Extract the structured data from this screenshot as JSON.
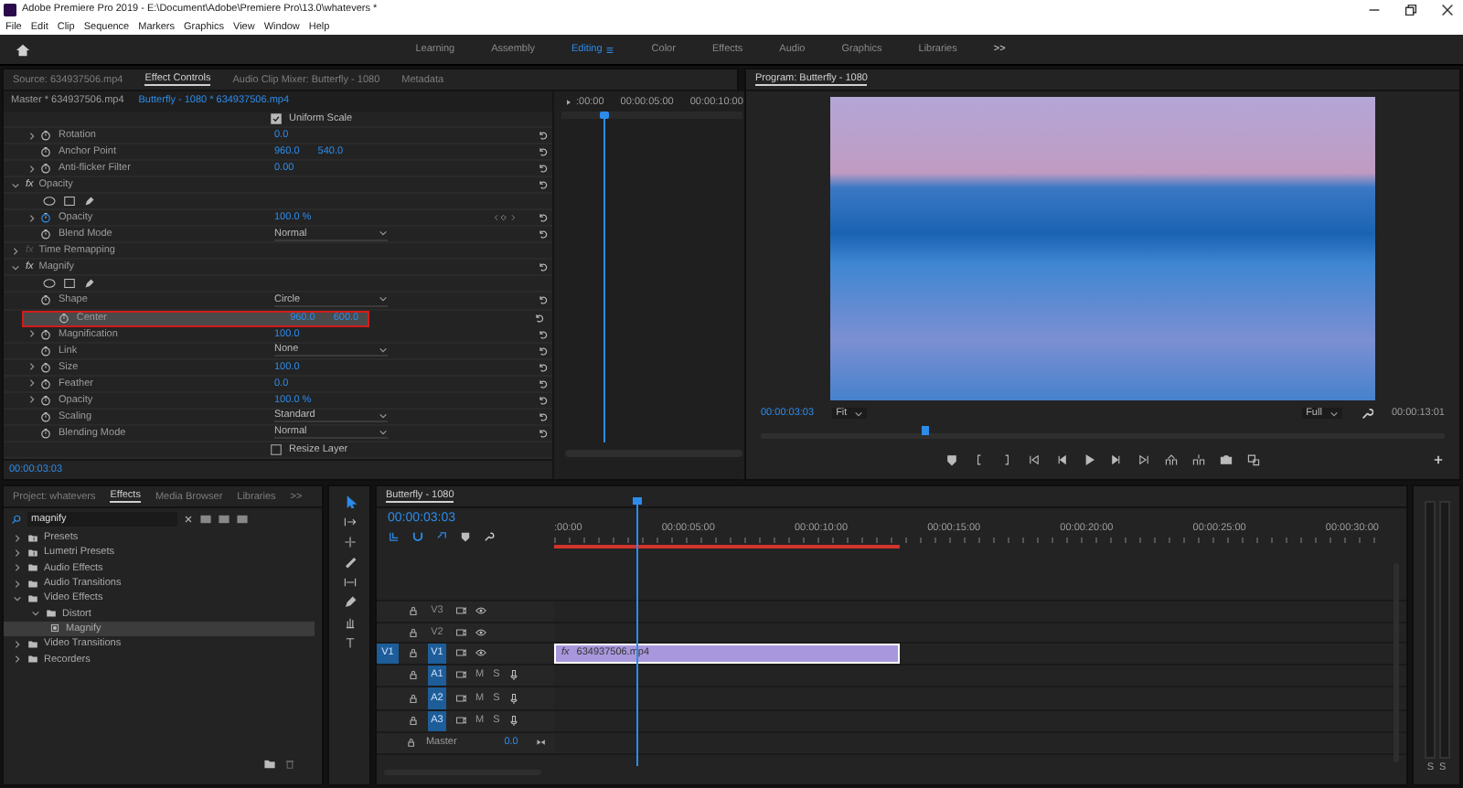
{
  "window": {
    "title": "Adobe Premiere Pro 2019 - E:\\Document\\Adobe\\Premiere Pro\\13.0\\whatevers *"
  },
  "menu": [
    "File",
    "Edit",
    "Clip",
    "Sequence",
    "Markers",
    "Graphics",
    "View",
    "Window",
    "Help"
  ],
  "workspaces": [
    {
      "label": "Learning",
      "selected": false
    },
    {
      "label": "Assembly",
      "selected": false
    },
    {
      "label": "Editing",
      "selected": true
    },
    {
      "label": "Color",
      "selected": false
    },
    {
      "label": "Effects",
      "selected": false
    },
    {
      "label": "Audio",
      "selected": false
    },
    {
      "label": "Graphics",
      "selected": false
    },
    {
      "label": "Libraries",
      "selected": false
    }
  ],
  "workspaces_more": ">>",
  "effect_controls": {
    "tabs": [
      {
        "label": "Source: 634937506.mp4",
        "selected": false
      },
      {
        "label": "Effect Controls",
        "selected": true
      },
      {
        "label": "Audio Clip Mixer: Butterfly - 1080",
        "selected": false
      },
      {
        "label": "Metadata",
        "selected": false
      }
    ],
    "master_clip": "Master * 634937506.mp4",
    "sequence_clip": "Butterfly - 1080 * 634937506.mp4",
    "ruler": [
      ":00:00",
      "00:00:05:00",
      "00:00:10:00"
    ],
    "playhead": {
      "level": 0.23
    },
    "rows": [
      {
        "kind": "checkbox",
        "label": "Uniform Scale",
        "checked": true
      },
      {
        "kind": "property",
        "name": "Rotation",
        "expandable": true,
        "selected": false,
        "values": [
          "0.0"
        ]
      },
      {
        "kind": "property",
        "name": "Anchor Point",
        "expandable": false,
        "selected": false,
        "values": [
          "960.0",
          "540.0"
        ]
      },
      {
        "kind": "property",
        "name": "Anti-flicker Filter",
        "expandable": true,
        "selected": false,
        "values": [
          "0.00"
        ]
      },
      {
        "kind": "section",
        "name": "Opacity",
        "badge": "fx",
        "badge_on": true,
        "expanded": true,
        "children": [
          {
            "kind": "masks"
          },
          {
            "kind": "animated",
            "name": "Opacity",
            "expandable": true,
            "selected": false,
            "values": [
              "100.0 %"
            ]
          },
          {
            "kind": "dropdown",
            "name": "Blend Mode",
            "selected": false,
            "value": "Normal"
          }
        ]
      },
      {
        "kind": "section",
        "name": "Time Remapping",
        "badge": "fx",
        "badge_on": false,
        "expanded": false
      },
      {
        "kind": "section",
        "name": "Magnify",
        "badge": "fx",
        "badge_on": true,
        "expanded": true,
        "children": [
          {
            "kind": "masks"
          },
          {
            "kind": "dropdown",
            "name": "Shape",
            "selected": false,
            "value": "Circle"
          },
          {
            "kind": "property",
            "name": "Center",
            "expandable": false,
            "selected": true,
            "values": [
              "960.0",
              "600.0"
            ]
          },
          {
            "kind": "property",
            "name": "Magnification",
            "expandable": true,
            "selected": false,
            "values": [
              "100.0"
            ]
          },
          {
            "kind": "dropdown",
            "name": "Link",
            "selected": false,
            "value": "None"
          },
          {
            "kind": "property",
            "name": "Size",
            "expandable": true,
            "selected": false,
            "values": [
              "100.0"
            ]
          },
          {
            "kind": "property",
            "name": "Feather",
            "expandable": true,
            "selected": false,
            "values": [
              "0.0"
            ]
          },
          {
            "kind": "property",
            "name": "Opacity",
            "expandable": true,
            "selected": false,
            "values": [
              "100.0 %"
            ]
          },
          {
            "kind": "dropdown",
            "name": "Scaling",
            "selected": false,
            "value": "Standard"
          },
          {
            "kind": "dropdown",
            "name": "Blending Mode",
            "selected": false,
            "value": "Normal"
          },
          {
            "kind": "checkbox",
            "label": "Resize Layer",
            "checked": false
          }
        ]
      }
    ],
    "timecode": "00:00:03:03"
  },
  "program": {
    "title": "Program: Butterfly - 1080",
    "timecode": "00:00:03:03",
    "zoom": "Fit",
    "resolution": "Full",
    "duration": "00:00:13:01",
    "playhead": {
      "level": 0.24
    }
  },
  "effects_panel": {
    "tabs": [
      {
        "label": "Project: whatevers",
        "selected": false
      },
      {
        "label": "Effects",
        "selected": true
      },
      {
        "label": "Media Browser",
        "selected": false
      },
      {
        "label": "Libraries",
        "selected": false
      }
    ],
    "more": ">>",
    "search": {
      "value": "magnify"
    },
    "tree": [
      {
        "kind": "preset-bin",
        "label": "Presets",
        "expanded": false,
        "selected": false
      },
      {
        "kind": "preset-bin",
        "label": "Lumetri Presets",
        "expanded": false,
        "selected": false
      },
      {
        "kind": "bin",
        "label": "Audio Effects",
        "expanded": false,
        "selected": false
      },
      {
        "kind": "bin",
        "label": "Audio Transitions",
        "expanded": false,
        "selected": false
      },
      {
        "kind": "bin",
        "label": "Video Effects",
        "expanded": true,
        "selected": false,
        "children": [
          {
            "kind": "bin",
            "label": "Distort",
            "expanded": true,
            "selected": false,
            "children": [
              {
                "kind": "effect",
                "label": "Magnify",
                "selected": true
              }
            ]
          }
        ]
      },
      {
        "kind": "bin",
        "label": "Video Transitions",
        "expanded": false,
        "selected": false
      },
      {
        "kind": "bin",
        "label": "Recorders",
        "expanded": false,
        "selected": false
      }
    ]
  },
  "timeline": {
    "tab": "Butterfly - 1080",
    "timecode": "00:00:03:03",
    "ruler": [
      ":00:00",
      "00:00:05:00",
      "00:00:10:00",
      "00:00:15:00",
      "00:00:20:00",
      "00:00:25:00",
      "00:00:30:00"
    ],
    "playhead": {
      "level": 0.1
    },
    "tracks": [
      {
        "kind": "video",
        "label": "V3",
        "targeted": false
      },
      {
        "kind": "video",
        "label": "V2",
        "targeted": false
      },
      {
        "kind": "video",
        "label": "V1",
        "targeted": true,
        "source_patch": "V1",
        "clip": {
          "badge": "fx",
          "label": "634937506.mp4"
        }
      },
      {
        "kind": "audio",
        "label": "A1",
        "targeted": true,
        "mute": "M",
        "solo": "S"
      },
      {
        "kind": "audio",
        "label": "A2",
        "targeted": true,
        "mute": "M",
        "solo": "S"
      },
      {
        "kind": "audio",
        "label": "A3",
        "targeted": true,
        "mute": "M",
        "solo": "S"
      },
      {
        "kind": "master",
        "label": "Master",
        "value": "0.0"
      }
    ]
  },
  "audio_meter": {
    "labels": [
      "S",
      "S"
    ]
  }
}
